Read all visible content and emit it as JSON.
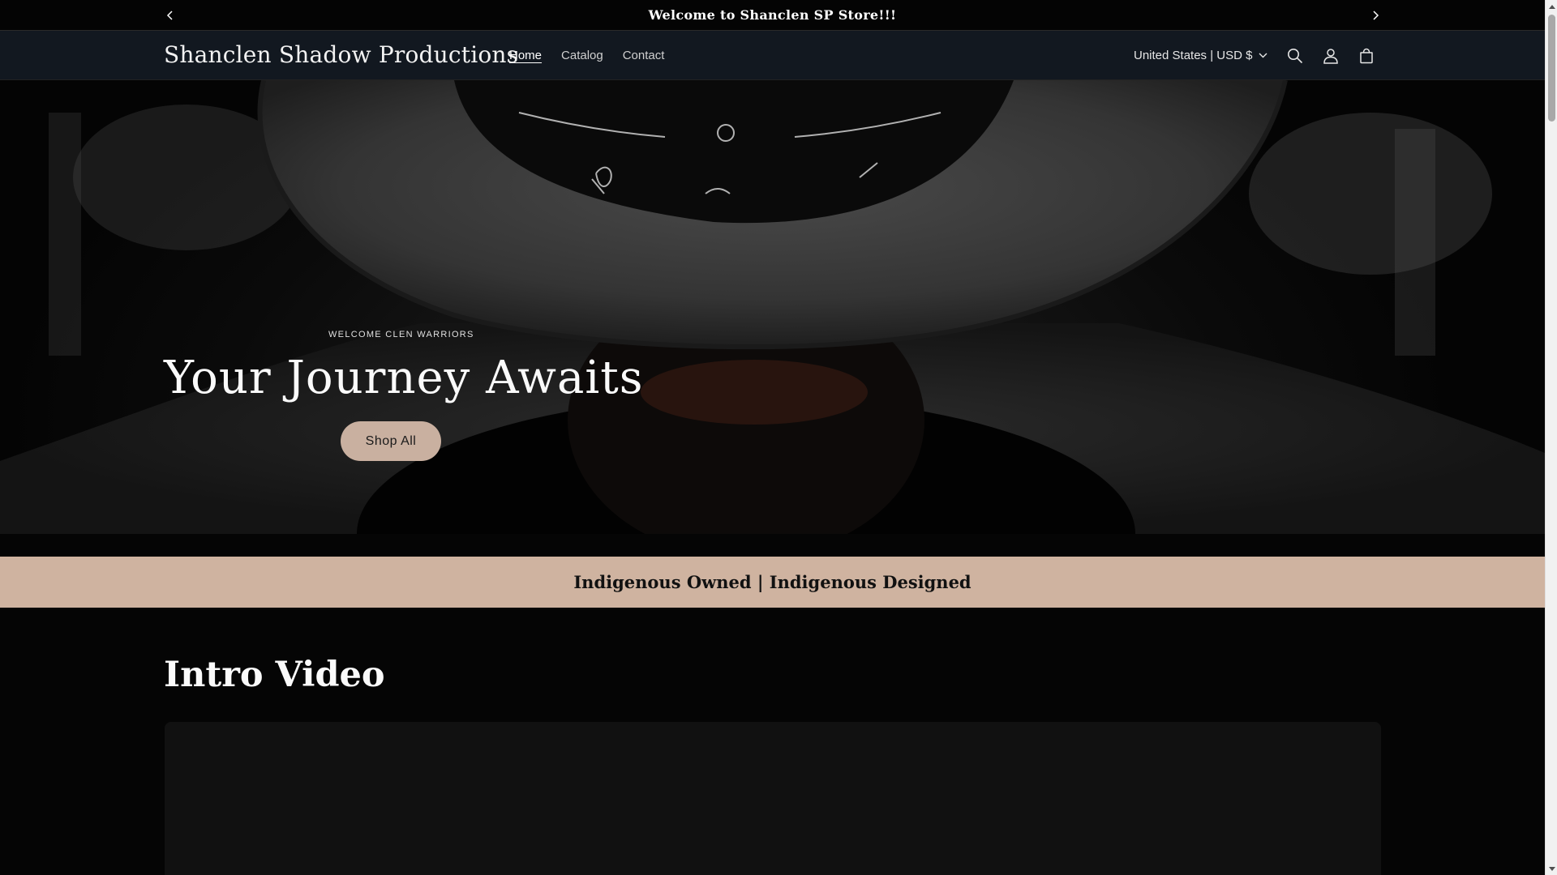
{
  "announcement": {
    "text": "Welcome to Shanclen SP Store!!!"
  },
  "header": {
    "logo": "Shanclen Shadow Productions",
    "nav": [
      {
        "label": "Home",
        "active": true
      },
      {
        "label": "Catalog",
        "active": false
      },
      {
        "label": "Contact",
        "active": false
      }
    ],
    "locale": "United States | USD $"
  },
  "hero": {
    "subheading": "WELCOME CLEN WARRIORS",
    "title": "Your Journey Awaits",
    "button_label": "Shop All"
  },
  "banner": {
    "text": "Indigenous Owned | Indigenous Designed"
  },
  "video_section": {
    "title": "Intro Video"
  },
  "colors": {
    "banner_bg": "#cfb3a0",
    "button_bg": "#c9b0a0",
    "header_bg": "#121820",
    "page_bg": "#050505"
  }
}
